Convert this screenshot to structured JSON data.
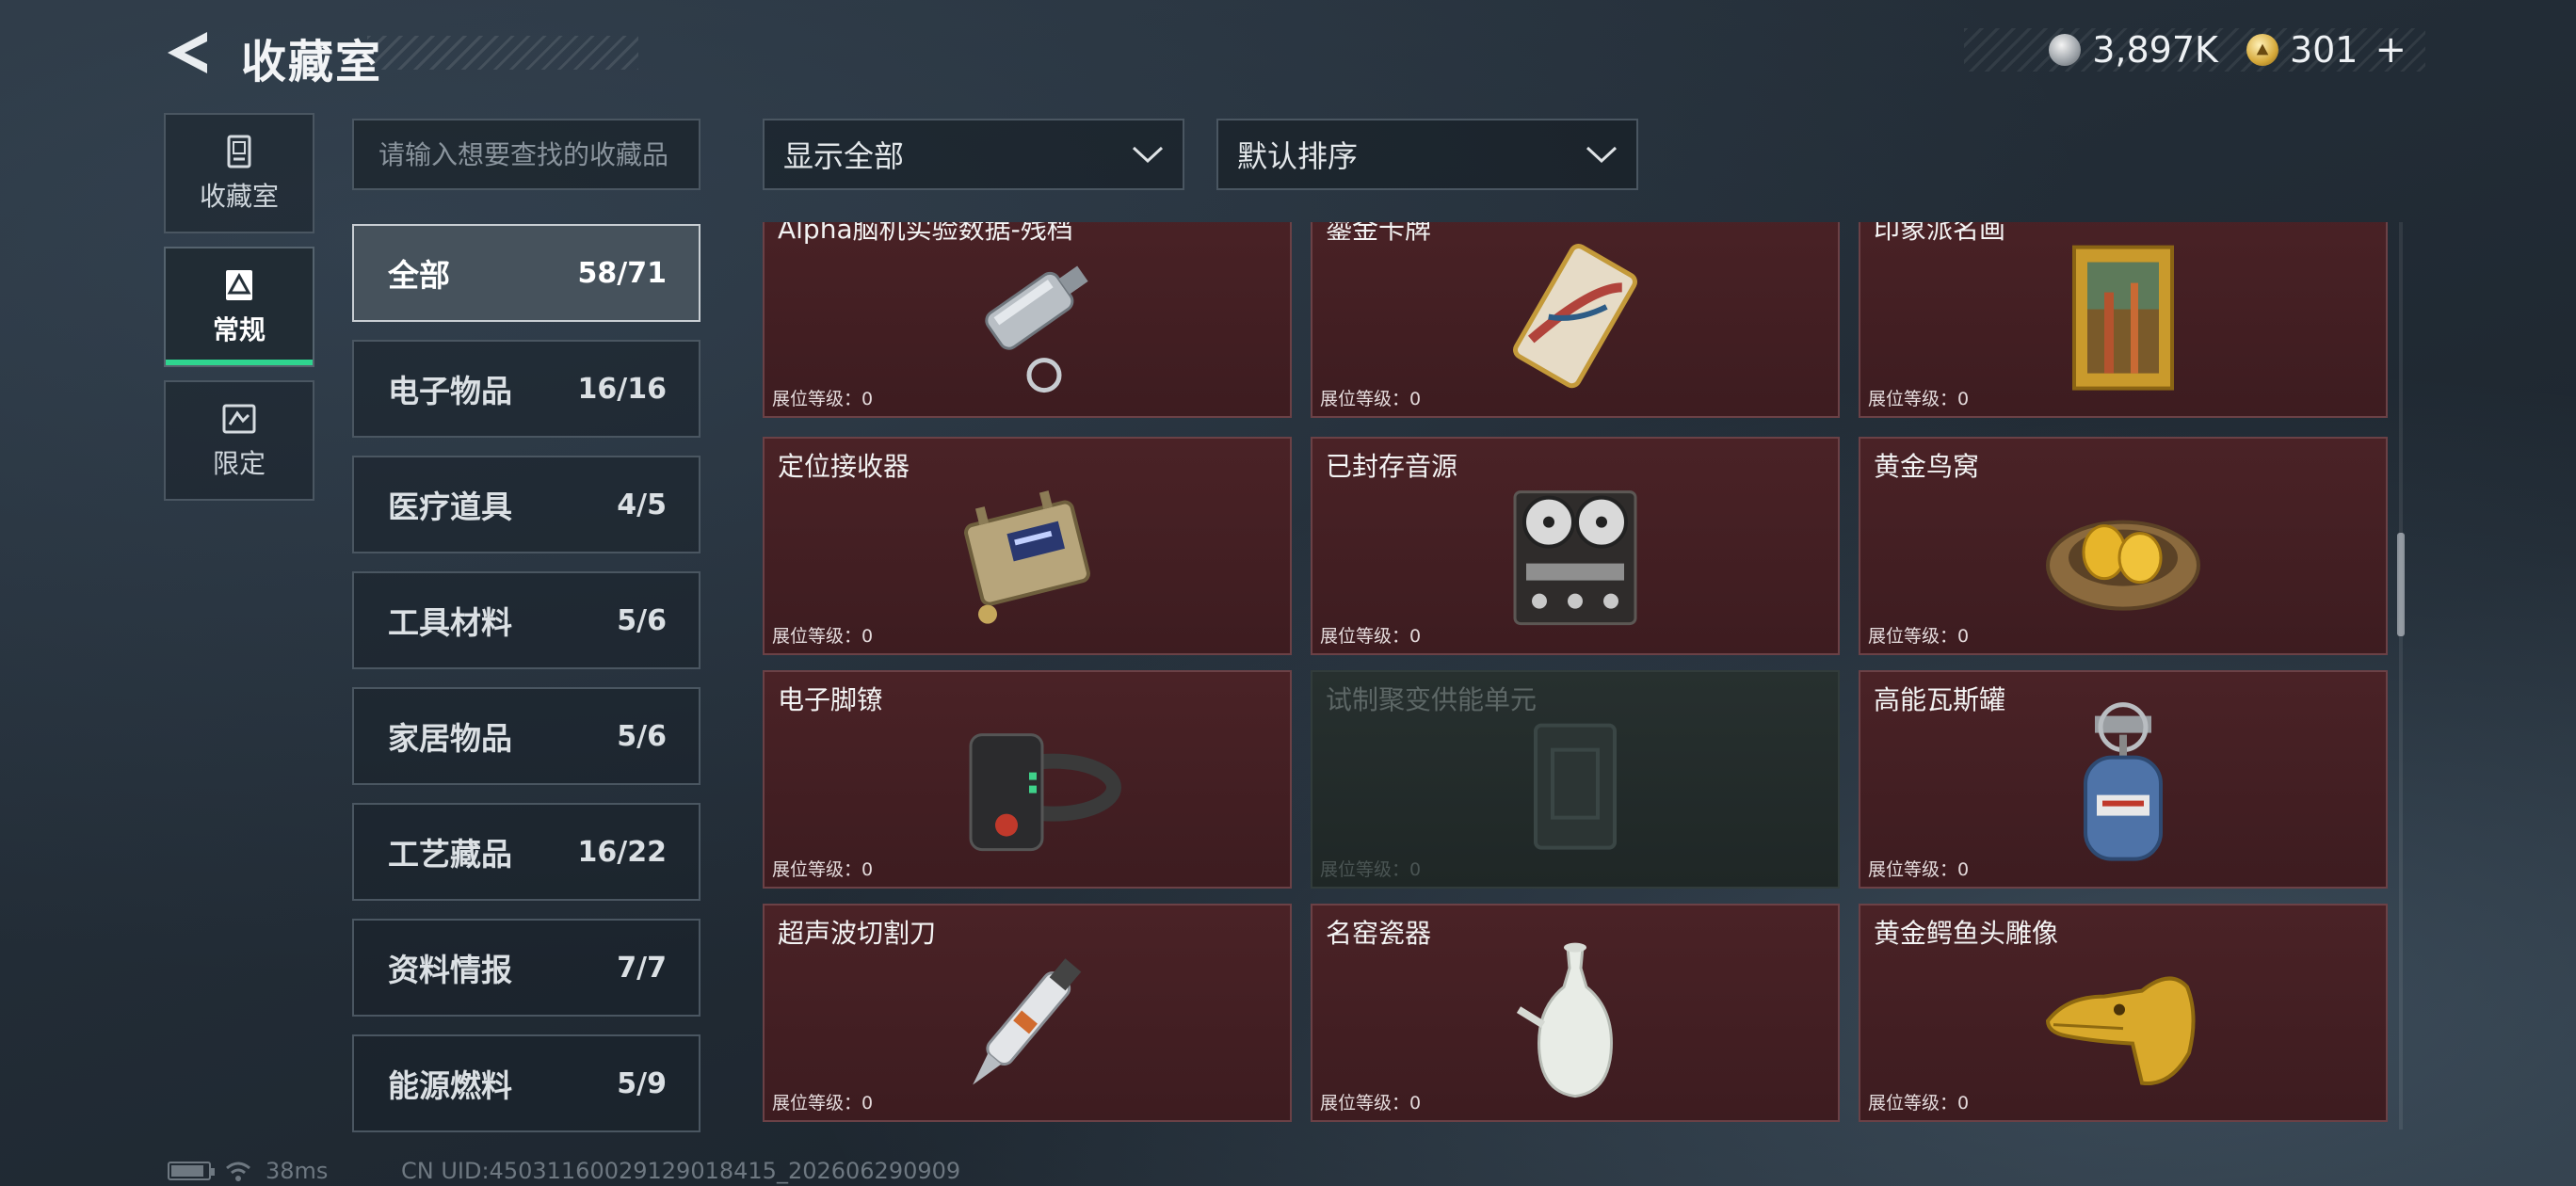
{
  "header": {
    "title": "收藏室",
    "currency": {
      "silver_amount": "3,897K",
      "gold_amount": "301",
      "add_label": "+"
    }
  },
  "side_tabs": [
    {
      "label": "收藏室",
      "icon": "archive-box-icon",
      "active": false
    },
    {
      "label": "常规",
      "icon": "document-triangle-icon",
      "active": true
    },
    {
      "label": "限定",
      "icon": "limited-card-icon",
      "active": false
    }
  ],
  "search": {
    "placeholder": "请输入想要查找的收藏品",
    "value": ""
  },
  "filters": {
    "display": {
      "selected": "显示全部",
      "icon": "chevron-down-icon"
    },
    "sort": {
      "selected": "默认排序",
      "icon": "chevron-down-icon"
    }
  },
  "categories": [
    {
      "name": "全部",
      "count": "58/71",
      "active": true
    },
    {
      "name": "电子物品",
      "count": "16/16"
    },
    {
      "name": "医疗道具",
      "count": "4/5"
    },
    {
      "name": "工具材料",
      "count": "5/6"
    },
    {
      "name": "家居物品",
      "count": "5/6"
    },
    {
      "name": "工艺藏品",
      "count": "16/22"
    },
    {
      "name": "资料情报",
      "count": "7/7"
    },
    {
      "name": "能源燃料",
      "count": "5/9"
    }
  ],
  "level_label": "展位等级：",
  "items": [
    {
      "name": "Alpha脑机实验数据-残档",
      "level": "0",
      "icon": "flash-drive-icon",
      "locked": false
    },
    {
      "name": "鎏金卡牌",
      "level": "0",
      "icon": "gilded-card-icon",
      "locked": false
    },
    {
      "name": "印象派名画",
      "level": "0",
      "icon": "framed-painting-icon",
      "locked": false
    },
    {
      "name": "定位接收器",
      "level": "0",
      "icon": "gps-receiver-icon",
      "locked": false
    },
    {
      "name": "已封存音源",
      "level": "0",
      "icon": "reel-to-reel-recorder-icon",
      "locked": false
    },
    {
      "name": "黄金鸟窝",
      "level": "0",
      "icon": "golden-nest-icon",
      "locked": false
    },
    {
      "name": "电子脚镣",
      "level": "0",
      "icon": "ankle-monitor-icon",
      "locked": false
    },
    {
      "name": "试制聚变供能单元",
      "level": "0",
      "icon": "fusion-cell-icon",
      "locked": true
    },
    {
      "name": "高能瓦斯罐",
      "level": "0",
      "icon": "gas-canister-icon",
      "locked": false
    },
    {
      "name": "超声波切割刀",
      "level": "0",
      "icon": "ultrasonic-cutter-icon",
      "locked": false
    },
    {
      "name": "名窑瓷器",
      "level": "0",
      "icon": "porcelain-vase-icon",
      "locked": false
    },
    {
      "name": "黄金鳄鱼头雕像",
      "level": "0",
      "icon": "golden-crocodile-statue-icon",
      "locked": false
    }
  ],
  "status": {
    "ping": "38ms",
    "uid": "CN UID:450311600291290184​15_202606290909"
  }
}
